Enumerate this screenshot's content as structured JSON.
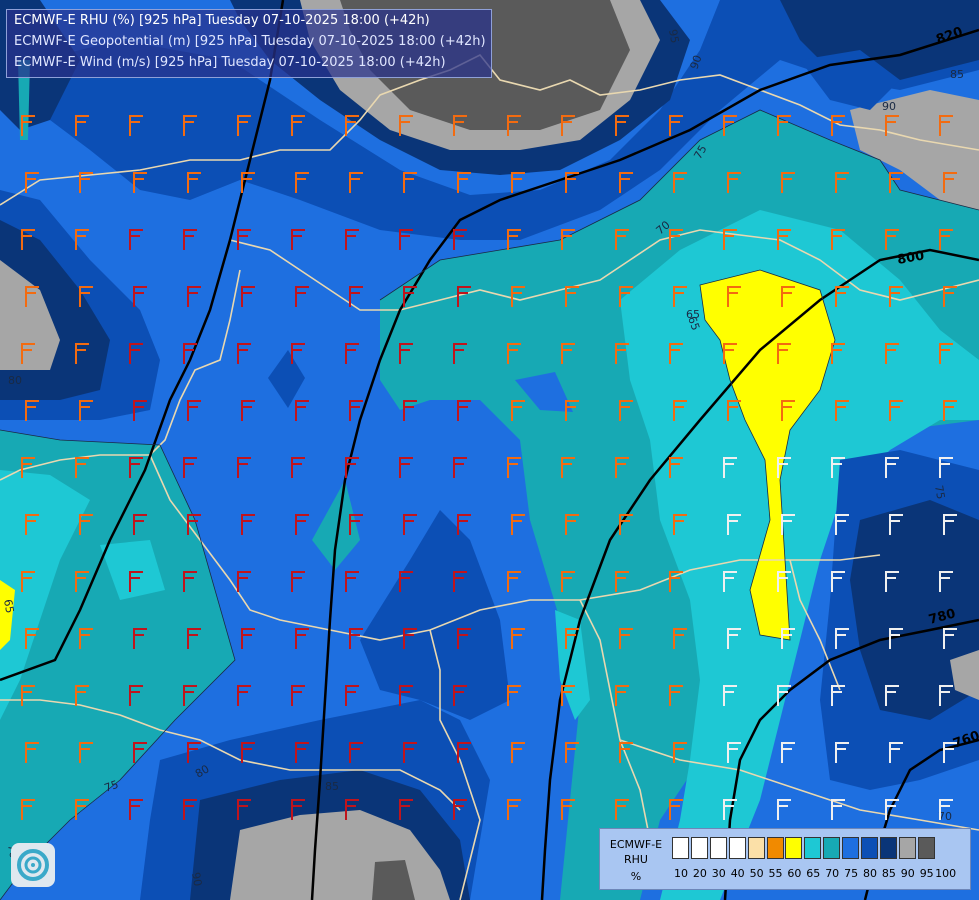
{
  "title": {
    "line1": "ECMWF-E RHU (%) [925 hPa] Tuesday 07-10-2025 18:00 (+42h)",
    "line2": "ECMWF-E Geopotential (m) [925 hPa] Tuesday 07-10-2025 18:00 (+42h)",
    "line3": "ECMWF-E Wind (m/s) [925 hPa] Tuesday 07-10-2025 18:00 (+42h)"
  },
  "legend": {
    "title_line1": "ECMWF-E",
    "title_line2": "RHU",
    "unit": "%",
    "ticks": [
      "10",
      "20",
      "30",
      "40",
      "50",
      "55",
      "60",
      "65",
      "70",
      "75",
      "80",
      "85",
      "90",
      "95",
      "100"
    ],
    "colors": [
      "#ffffff",
      "#ffffff",
      "#ffffff",
      "#ffffff",
      "#fbe0a8",
      "#f18a00",
      "#ffff00",
      "#1ec8d4",
      "#17a9b4",
      "#1e6fe0",
      "#0c4fb5",
      "#0a3578",
      "#a6a6a6",
      "#5a5a5a"
    ]
  },
  "contour_labels": {
    "geopotential": [
      "820",
      "800",
      "780",
      "760"
    ],
    "rhu": [
      "95",
      "90",
      "85",
      "90",
      "80",
      "75",
      "70",
      "65",
      "65",
      "80",
      "85",
      "75",
      "70",
      "90",
      "65",
      "75",
      "70"
    ]
  },
  "colors": {
    "rhu_65": "#ffff00",
    "rhu_70": "#1ec8d4",
    "rhu_75": "#17a9b4",
    "rhu_80": "#1e6fe0",
    "rhu_85": "#0c4fb5",
    "rhu_90": "#0a3578",
    "rhu_95": "#a6a6a6",
    "rhu_100": "#5a5a5a",
    "border": "#e9d8b0",
    "geopotential_contour": "#000000"
  },
  "icons": {
    "logo": "ecmwf-logo-icon",
    "barbs": "wind-barb-icon"
  }
}
